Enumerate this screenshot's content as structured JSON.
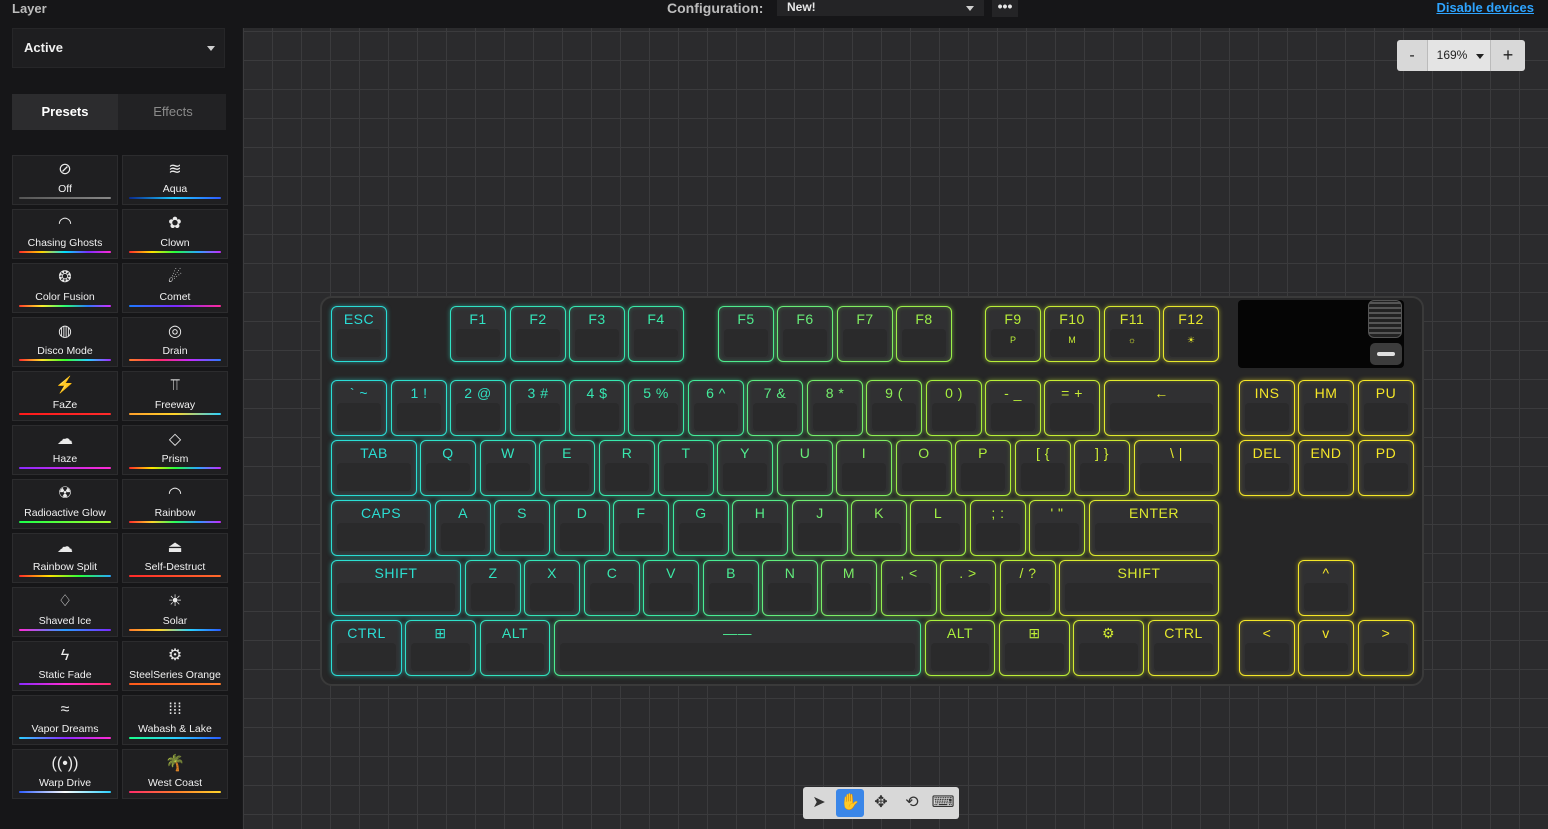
{
  "top": {
    "layer_title": "Layer",
    "config_label": "Configuration:",
    "config_value": "New!",
    "more": "•••",
    "disable_devices": "Disable devices"
  },
  "sidebar": {
    "layer_value": "Active",
    "tabs": [
      "Presets",
      "Effects"
    ],
    "presets": [
      {
        "label": "Off",
        "icon": "⊘",
        "icon_name": "off-icon"
      },
      {
        "label": "Aqua",
        "icon": "≋",
        "icon_name": "waves-icon"
      },
      {
        "label": "Chasing Ghosts",
        "icon": "◠",
        "icon_name": "ghost-icon"
      },
      {
        "label": "Clown",
        "icon": "✿",
        "icon_name": "clown-icon"
      },
      {
        "label": "Color Fusion",
        "icon": "❂",
        "icon_name": "color-fusion-icon"
      },
      {
        "label": "Comet",
        "icon": "☄",
        "icon_name": "comet-icon"
      },
      {
        "label": "Disco Mode",
        "icon": "◍",
        "icon_name": "disco-ball-icon"
      },
      {
        "label": "Drain",
        "icon": "◎",
        "icon_name": "spiral-icon"
      },
      {
        "label": "FaZe",
        "icon": "⚡",
        "icon_name": "faze-icon"
      },
      {
        "label": "Freeway",
        "icon": "⫪",
        "icon_name": "road-icon"
      },
      {
        "label": "Haze",
        "icon": "☁",
        "icon_name": "haze-icon"
      },
      {
        "label": "Prism",
        "icon": "◇",
        "icon_name": "prism-icon"
      },
      {
        "label": "Radioactive Glow",
        "icon": "☢",
        "icon_name": "radioactive-icon"
      },
      {
        "label": "Rainbow",
        "icon": "◠",
        "icon_name": "rainbow-icon"
      },
      {
        "label": "Rainbow Split",
        "icon": "☁",
        "icon_name": "rainbow-split-icon"
      },
      {
        "label": "Self-Destruct",
        "icon": "⏏",
        "icon_name": "alarm-icon"
      },
      {
        "label": "Shaved Ice",
        "icon": "♢",
        "icon_name": "ice-cream-icon"
      },
      {
        "label": "Solar",
        "icon": "☀",
        "icon_name": "sunrise-icon"
      },
      {
        "label": "Static Fade",
        "icon": "ϟ",
        "icon_name": "bolt-icon"
      },
      {
        "label": "SteelSeries Orange",
        "icon": "⚙",
        "icon_name": "steelseries-icon"
      },
      {
        "label": "Vapor Dreams",
        "icon": "≈",
        "icon_name": "vapor-icon"
      },
      {
        "label": "Wabash & Lake",
        "icon": "⁞⁞⁞",
        "icon_name": "dots-icon"
      },
      {
        "label": "Warp Drive",
        "icon": "((•))",
        "icon_name": "broadcast-icon"
      },
      {
        "label": "West Coast",
        "icon": "🌴",
        "icon_name": "palm-tree-icon"
      }
    ]
  },
  "zoom": {
    "minus": "-",
    "value": "169%",
    "plus": "+"
  },
  "keys": {
    "esc": "ESC",
    "f1": "F1",
    "f2": "F2",
    "f3": "F3",
    "f4": "F4",
    "f5": "F5",
    "f6": "F6",
    "f7": "F7",
    "f8": "F8",
    "f9": "F9",
    "f10": "F10",
    "f11": "F11",
    "f12": "F12",
    "f9_sub": "P",
    "f10_sub": "M",
    "f11_sub": "☼",
    "f12_sub": "☀",
    "grave": "` ~",
    "d1": "1 !",
    "d2": "2 @",
    "d3": "3 #",
    "d4": "4 $",
    "d5": "5 %",
    "d6": "6 ^",
    "d7": "7 &",
    "d8": "8 *",
    "d9": "9 (",
    "d0": "0 )",
    "minus": "- _",
    "equal": "= +",
    "backspace": "←",
    "ins": "INS",
    "hm": "HM",
    "pu": "PU",
    "tab": "TAB",
    "q": "Q",
    "w": "W",
    "e": "E",
    "r": "R",
    "t": "T",
    "y": "Y",
    "u": "U",
    "i": "I",
    "o": "O",
    "p": "P",
    "lbracket": "[ {",
    "rbracket": "] }",
    "backslash": "\\ |",
    "del": "DEL",
    "end": "END",
    "pd": "PD",
    "caps": "CAPS",
    "a": "A",
    "s": "S",
    "d": "D",
    "f": "F",
    "g": "G",
    "h": "H",
    "j": "J",
    "k": "K",
    "l": "L",
    "semicolon": "; :",
    "quote": "' \"",
    "enter": "ENTER",
    "lshift": "SHIFT",
    "z": "Z",
    "x": "X",
    "c": "C",
    "v": "V",
    "b": "B",
    "n": "N",
    "m": "M",
    "comma": ", <",
    "period": ". >",
    "slash": "/ ?",
    "rshift": "SHIFT",
    "up": "^",
    "lctrl": "CTRL",
    "lwin": "⊞",
    "lalt": "ALT",
    "space": "——",
    "ralt": "ALT",
    "rwin": "⊞",
    "fn": "⚙",
    "rctrl": "CTRL",
    "left": "<",
    "down": "v",
    "right": ">"
  },
  "toolbar": {
    "select": "➤",
    "pan": "✋",
    "move": "✥",
    "rotate": "⟲",
    "keyboard": "⌨"
  }
}
